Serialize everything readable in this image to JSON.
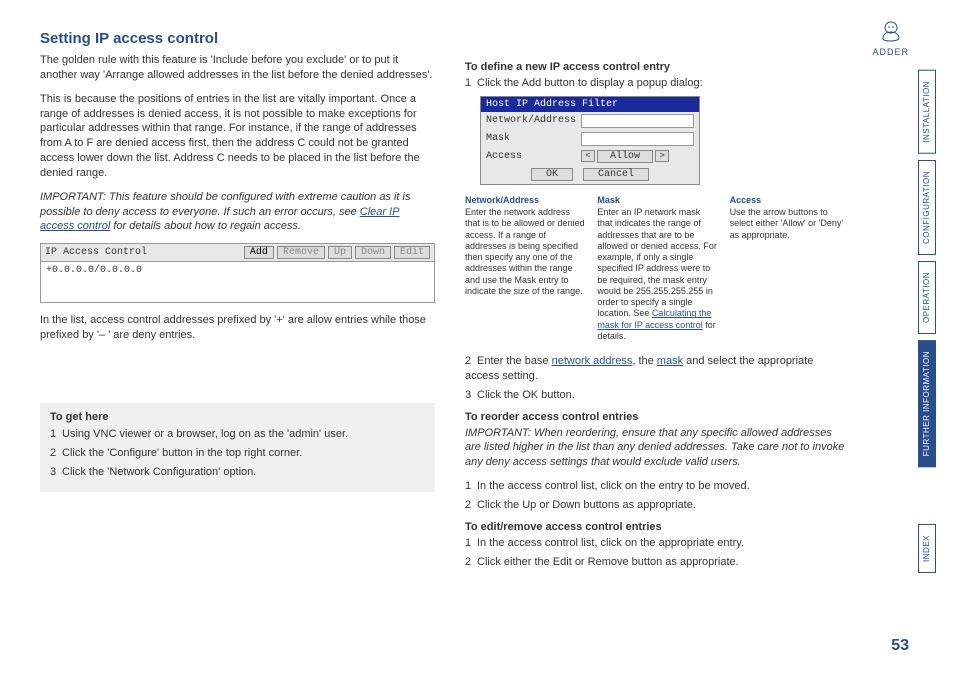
{
  "title": "Setting IP access control",
  "left": {
    "p1": "The golden rule with this feature is 'Include before you exclude' or to put it another way 'Arrange allowed addresses in the list before the denied addresses'.",
    "p2": "This is because the positions of entries in the list are vitally important. Once a range of addresses is denied access, it is not possible to make exceptions for particular addresses within that range. For instance, if the range of addresses from A to F are denied access first, then the address C could not be granted access lower down the list. Address C needs to be placed in the list before the denied range.",
    "p3a": "IMPORTANT: This feature should be configured with extreme caution as it is possible to deny access to everyone. If such an error occurs, see ",
    "p3link": "Clear IP access control",
    "p3b": " for details about how to regain access.",
    "screenshot": {
      "title": "IP Access Control",
      "btn_add": "Add",
      "btn_remove": "Remove",
      "btn_up": "Up",
      "btn_down": "Down",
      "btn_edit": "Edit",
      "entry": "+0.0.0.0/0.0.0.0"
    },
    "p4": "In the list, access control addresses prefixed by '+' are allow entries while those prefixed by '– ' are deny entries.",
    "gethere": {
      "title": "To get here",
      "s1": "Using VNC viewer or a browser, log on as the 'admin' user.",
      "s2": "Click the 'Configure' button in the top right corner.",
      "s3": "Click the 'Network Configuration' option."
    }
  },
  "right": {
    "h1": "To define a new IP access control entry",
    "s1": "Click the Add button to display a popup dialog:",
    "dialog": {
      "title": "Host IP Address Filter",
      "row1": "Network/Address",
      "row2": "Mask",
      "row3": "Access",
      "access_val": "Allow",
      "ok": "OK",
      "cancel": "Cancel"
    },
    "defs": {
      "na_title": "Network/Address",
      "na_body": "Enter the network address that is to be allowed or denied access. If a range of addresses is being specified then specify any one of the addresses within the range and use the Mask entry to indicate the size of the range.",
      "mask_title": "Mask",
      "mask_body": "Enter an IP network mask that indicates the range of addresses that are to be allowed or denied access. For example, if only a single specified IP address were to be required, the mask entry would be 255.255.255.255 in order to specify a single location. See ",
      "mask_link": "Calculating the mask for IP access control",
      "mask_body2": " for details.",
      "acc_title": "Access",
      "acc_body": "Use the arrow buttons to select either 'Allow' or 'Deny' as appropriate."
    },
    "s2a": "Enter the base ",
    "s2link1": "network address",
    "s2b": ", the ",
    "s2link2": "mask",
    "s2c": " and select the appropriate access setting.",
    "s3": "Click the OK button.",
    "h2": "To reorder access control entries",
    "p_reorder": "IMPORTANT: When reordering, ensure that any specific allowed addresses are listed higher in the list than any denied addresses. Take care not to invoke any deny access settings that would exclude valid users.",
    "r1": "In the access control list, click on the entry to be moved.",
    "r2": "Click the Up or Down buttons as appropriate.",
    "h3": "To edit/remove access control entries",
    "e1": "In the access control list, click on the appropriate entry.",
    "e2": "Click either the Edit or Remove button as appropriate."
  },
  "nav": {
    "t1": "INSTALLATION",
    "t2": "CONFIGURATION",
    "t3": "OPERATION",
    "t4": "FURTHER INFORMATION",
    "t5": "INDEX"
  },
  "logo_text": "ADDER",
  "page_number": "53"
}
